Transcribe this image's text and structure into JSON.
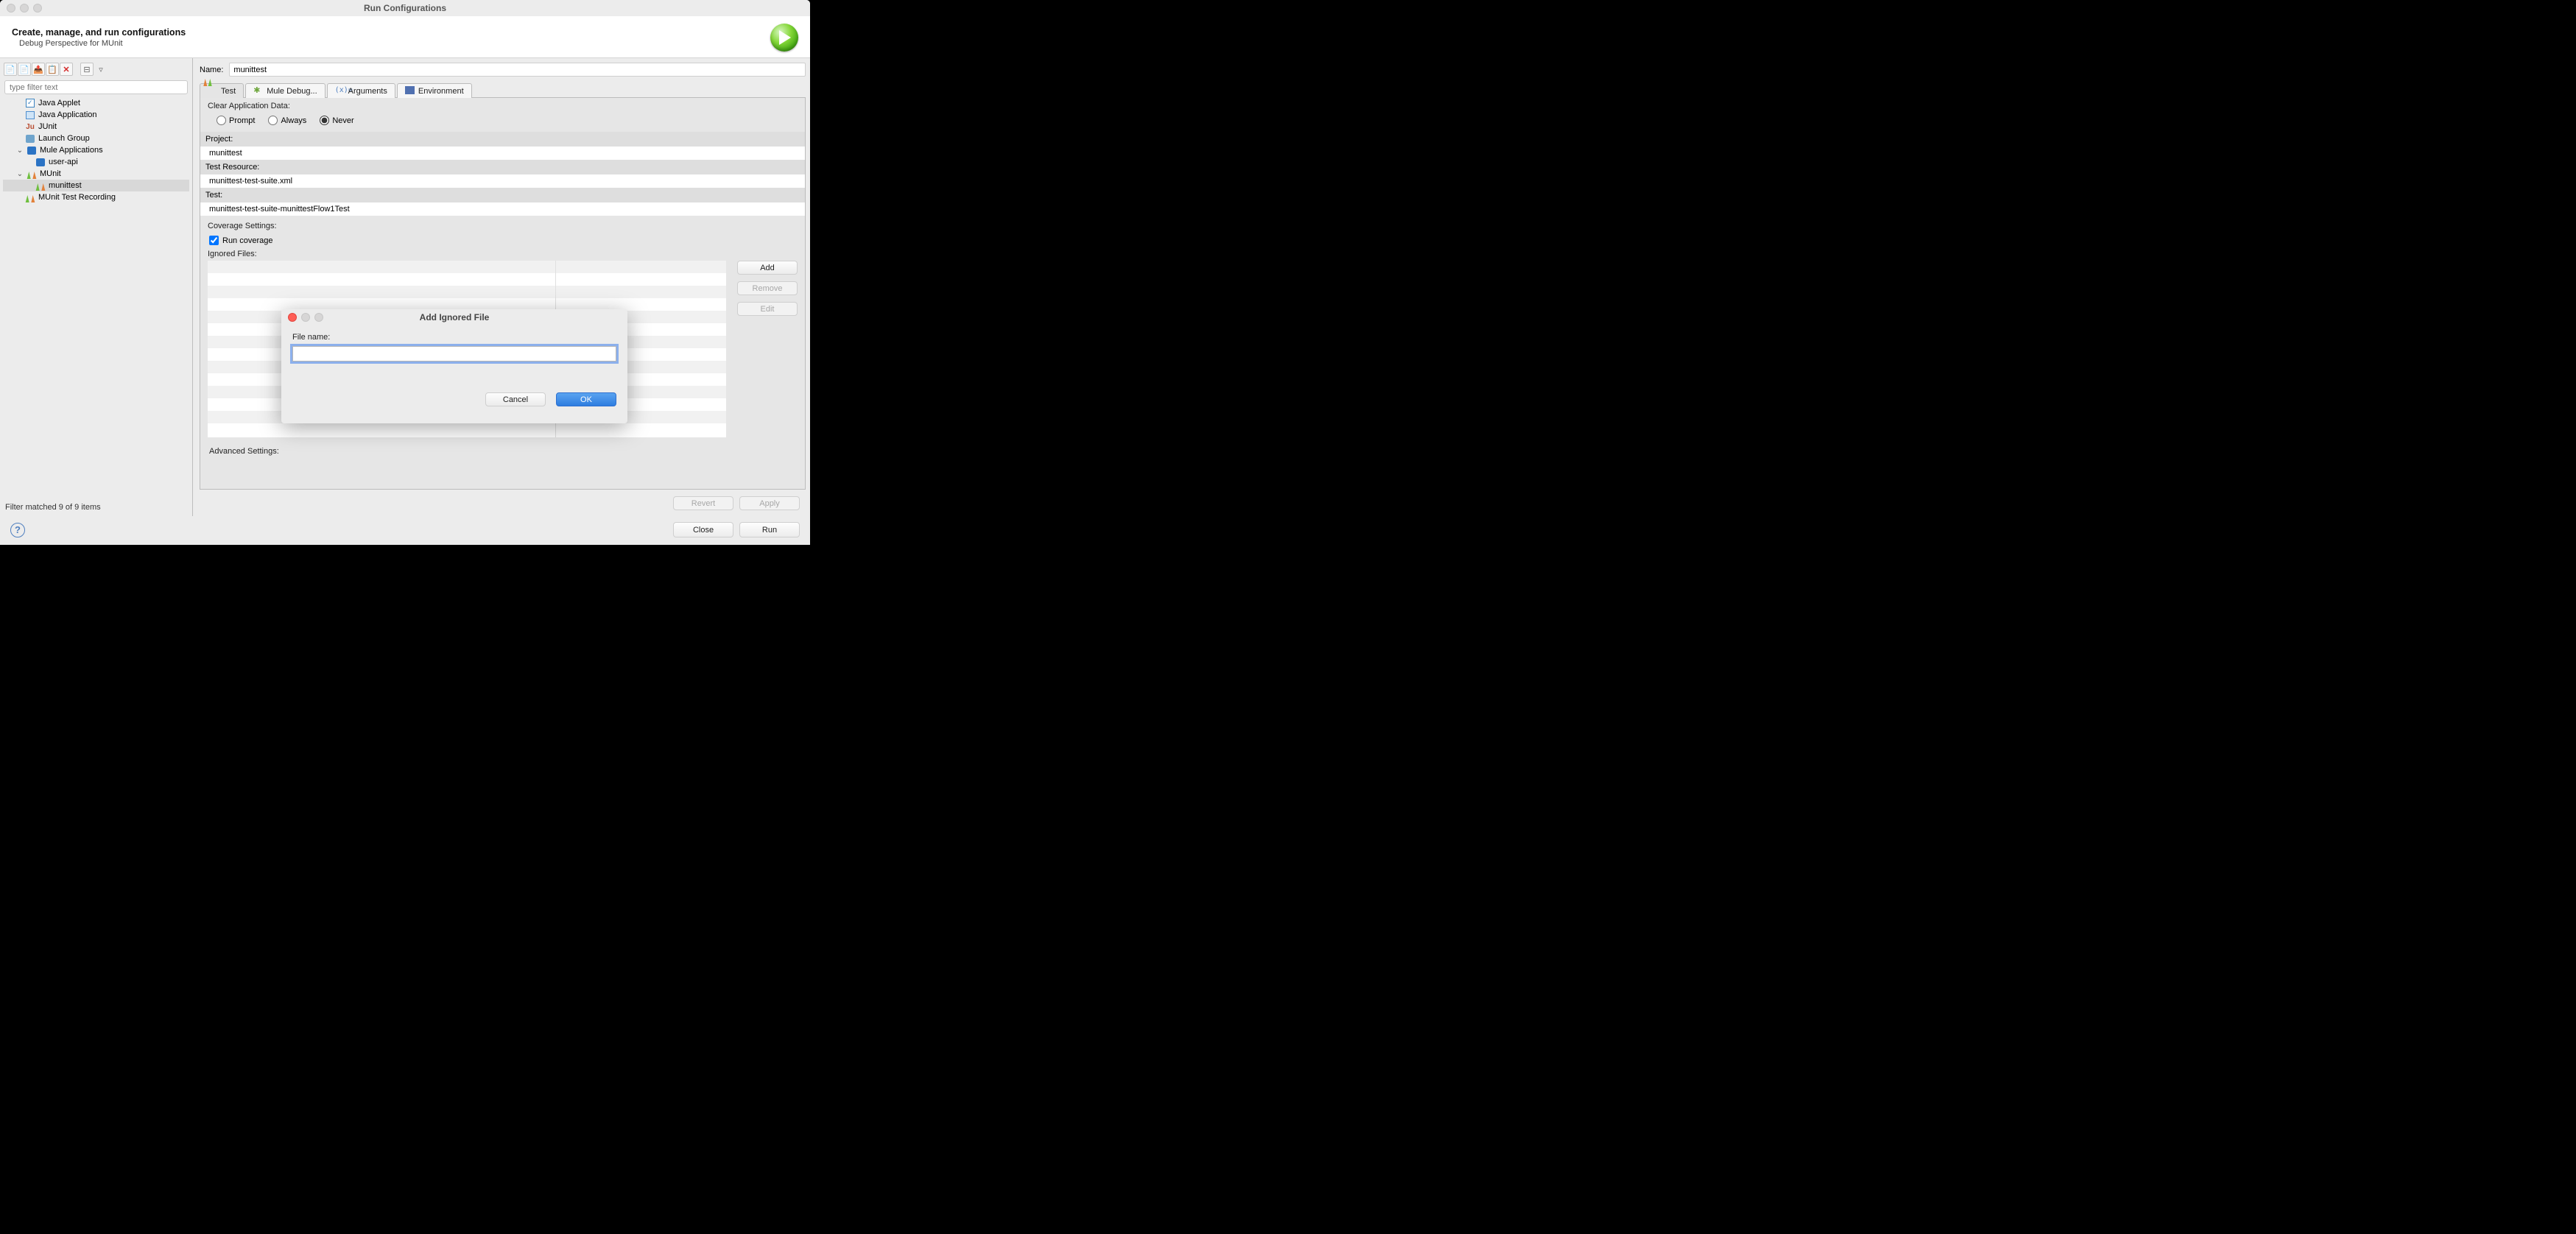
{
  "window": {
    "title": "Run Configurations",
    "header_title": "Create, manage, and run configurations",
    "header_subtitle": "Debug Perspective for MUnit"
  },
  "left": {
    "filter_placeholder": "type filter text",
    "footer": "Filter matched 9 of 9 items",
    "items": {
      "java_applet": "Java Applet",
      "java_application": "Java Application",
      "junit": "JUnit",
      "launch_group": "Launch Group",
      "mule_applications": "Mule Applications",
      "user_api": "user-api",
      "munit": "MUnit",
      "munittest": "munittest",
      "munit_test_recording": "MUnit Test Recording"
    }
  },
  "right": {
    "name_label": "Name:",
    "name_value": "munittest",
    "tabs": {
      "test": "Test",
      "mule_debug": "Mule Debug...",
      "arguments": "Arguments",
      "environment": "Environment"
    },
    "clear_app_data_label": "Clear Application Data:",
    "radio_prompt": "Prompt",
    "radio_always": "Always",
    "radio_never": "Never",
    "project_label": "Project:",
    "project_value": "munittest",
    "test_resource_label": "Test Resource:",
    "test_resource_value": "munittest-test-suite.xml",
    "test_label": "Test:",
    "test_value": "munittest-test-suite-munittestFlow1Test",
    "coverage_settings_label": "Coverage Settings:",
    "run_coverage_label": "Run coverage",
    "ignored_files_label": "Ignored Files:",
    "add_btn": "Add",
    "remove_btn": "Remove",
    "edit_btn": "Edit",
    "advanced_settings_label": "Advanced Settings:",
    "revert_btn": "Revert",
    "apply_btn": "Apply"
  },
  "footer": {
    "close_btn": "Close",
    "run_btn": "Run"
  },
  "modal": {
    "title": "Add Ignored File",
    "file_name_label": "File name:",
    "file_name_value": "",
    "cancel_btn": "Cancel",
    "ok_btn": "OK"
  }
}
